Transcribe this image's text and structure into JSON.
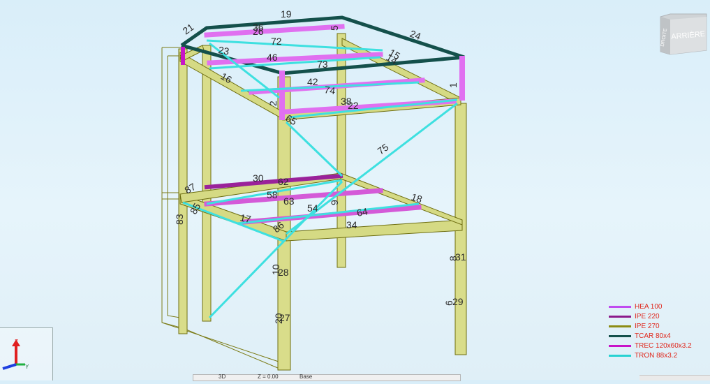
{
  "view_cube": {
    "face_label": "ARRIÈRE",
    "side_label": "DROITE"
  },
  "legend": [
    {
      "label": "HEA 100",
      "color": "#c04cf0"
    },
    {
      "label": "IPE 220",
      "color": "#8c1a8c"
    },
    {
      "label": "IPE 270",
      "color": "#8c8c14"
    },
    {
      "label": "TCAR 80x4",
      "color": "#14504b"
    },
    {
      "label": "TREC 120x60x3.2",
      "color": "#c814c8"
    },
    {
      "label": "TRON 88x3.2",
      "color": "#28d2d2"
    }
  ],
  "axes": {
    "z": "Z",
    "y": "Y"
  },
  "member_labels": [
    "19",
    "21",
    "26",
    "36",
    "5",
    "72",
    "24",
    "23",
    "46",
    "14",
    "15",
    "73",
    "1",
    "16",
    "42",
    "74",
    "38",
    "22",
    "2",
    "65",
    "75",
    "30",
    "62",
    "87",
    "58",
    "63",
    "9",
    "18",
    "85",
    "54",
    "64",
    "17",
    "34",
    "86",
    "83",
    "8",
    "31",
    "10",
    "28",
    "6",
    "29",
    "20",
    "27"
  ],
  "status_bar": {
    "left": "3D",
    "mid": "Z = 0.00",
    "right": "Base"
  }
}
